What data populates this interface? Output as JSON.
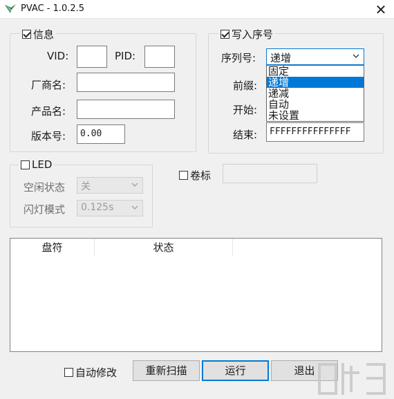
{
  "window": {
    "title": "PVAC - 1.0.2.5",
    "close_glyph": "✕"
  },
  "info_group": {
    "legend": "信息",
    "checked": true,
    "vid_label": "VID:",
    "vid_value": "",
    "pid_label": "PID:",
    "pid_value": "",
    "vendor_label": "厂商名:",
    "vendor_value": "",
    "product_label": "产品名:",
    "product_value": "",
    "version_label": "版本号:",
    "version_value": "0.00"
  },
  "serial_group": {
    "legend": "写入序号",
    "checked": true,
    "serial_label": "序列号:",
    "serial_selected": "递增",
    "prefix_label": "前缀:",
    "start_label": "开始:",
    "end_label": "结束:",
    "end_value": "FFFFFFFFFFFFFFF",
    "dropdown_options": [
      "固定",
      "递增",
      "递减",
      "自动",
      "未设置"
    ],
    "dropdown_selected_index": 1
  },
  "led_group": {
    "legend": "LED",
    "checked": false,
    "idle_label": "空闲状态",
    "idle_value": "关",
    "blink_label": "闪灯模式",
    "blink_value": "0.125s"
  },
  "volume": {
    "label": "卷标",
    "checked": false,
    "value": ""
  },
  "table": {
    "columns": [
      "盘符",
      "状态"
    ],
    "rows": []
  },
  "footer": {
    "auto_modify_label": "自动修改",
    "auto_modify_checked": false,
    "rescan_label": "重新扫描",
    "run_label": "运行",
    "exit_label": "退出"
  },
  "colors": {
    "accent": "#0078d7",
    "panel": "#f0f0f0",
    "border": "#d6d6d6"
  }
}
